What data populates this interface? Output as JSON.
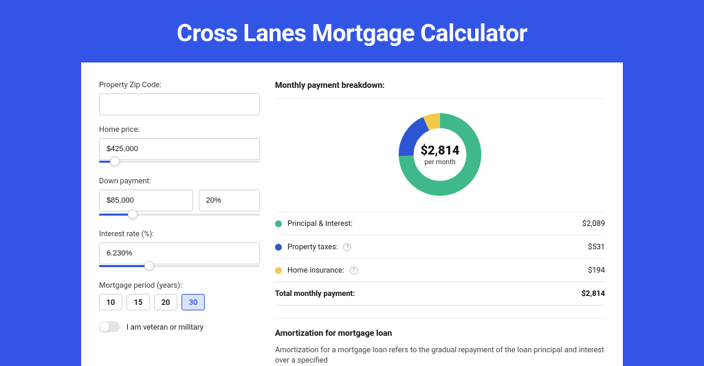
{
  "title": "Cross Lanes Mortgage Calculator",
  "left": {
    "zip_label": "Property Zip Code:",
    "zip_value": "",
    "price_label": "Home price:",
    "price_value": "$425,000",
    "price_slider_pct": 10,
    "down_label": "Down payment:",
    "down_value": "$85,000",
    "down_pct": "20%",
    "down_slider_pct": 21,
    "rate_label": "Interest rate (%):",
    "rate_value": "6.230%",
    "rate_slider_pct": 31,
    "period_label": "Mortgage period (years):",
    "periods": [
      "10",
      "15",
      "20",
      "30"
    ],
    "period_selected": "30",
    "veteran_label": "I am veteran or military"
  },
  "right": {
    "breakdown_title": "Monthly payment breakdown:",
    "center_amount": "$2,814",
    "center_sub": "per month",
    "rows": [
      {
        "label": "Principal & Interest:",
        "value": "$2,089"
      },
      {
        "label": "Property taxes:",
        "value": "$531"
      },
      {
        "label": "Home insurance:",
        "value": "$194"
      }
    ],
    "total_label": "Total monthly payment:",
    "total_value": "$2,814",
    "amort_title": "Amortization for mortgage loan",
    "amort_text": "Amortization for a mortgage loan refers to the gradual repayment of the loan principal and interest over a specified"
  },
  "chart_data": {
    "type": "pie",
    "title": "Monthly payment breakdown",
    "series": [
      {
        "name": "Principal & Interest",
        "value": 2089,
        "color": "#3fb98a"
      },
      {
        "name": "Property taxes",
        "value": 531,
        "color": "#2d55d4"
      },
      {
        "name": "Home insurance",
        "value": 194,
        "color": "#f4c94b"
      }
    ],
    "total": 2814,
    "center_label": "$2,814 per month"
  }
}
